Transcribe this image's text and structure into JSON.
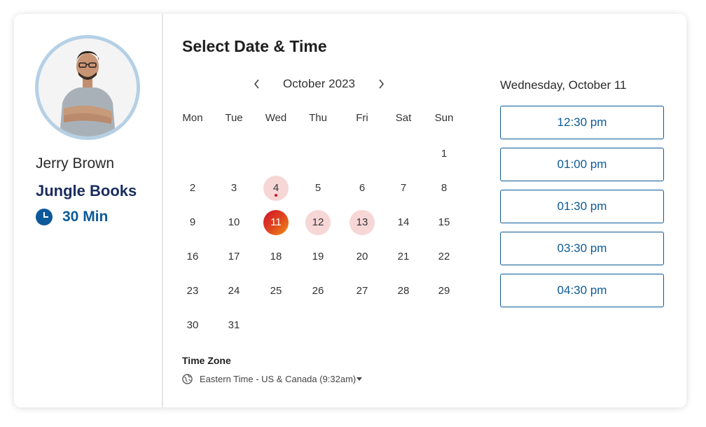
{
  "host": {
    "name": "Jerry Brown",
    "event_name": "Jungle Books",
    "duration": "30 Min",
    "duration_icon": "clock-icon"
  },
  "scheduler": {
    "title": "Select Date & Time",
    "month_label": "October 2023",
    "prev_icon": "chevron-left-icon",
    "next_icon": "chevron-right-icon",
    "weekdays": [
      "Mon",
      "Tue",
      "Wed",
      "Thu",
      "Fri",
      "Sat",
      "Sun"
    ],
    "weeks": [
      [
        "",
        "",
        "",
        "",
        "",
        "",
        "1"
      ],
      [
        "2",
        "3",
        "4",
        "5",
        "6",
        "7",
        "8"
      ],
      [
        "9",
        "10",
        "11",
        "12",
        "13",
        "14",
        "15"
      ],
      [
        "16",
        "17",
        "18",
        "19",
        "20",
        "21",
        "22"
      ],
      [
        "23",
        "24",
        "25",
        "26",
        "27",
        "28",
        "29"
      ],
      [
        "30",
        "31",
        "",
        "",
        "",
        "",
        ""
      ]
    ],
    "today": "4",
    "selected_day": "11",
    "available_days": [
      "4",
      "12",
      "13"
    ]
  },
  "timezone": {
    "label": "Time Zone",
    "value": "Eastern Time - US & Canada (9:32am)",
    "icon": "globe-icon"
  },
  "times": {
    "selected_date": "Wednesday, October 11",
    "slots": [
      "12:30 pm",
      "01:00 pm",
      "01:30 pm",
      "03:30 pm",
      "04:30 pm"
    ]
  },
  "colors": {
    "brand_blue": "#0c5a99",
    "navy_text": "#1a2d5e",
    "available_pink": "#f7d6d6",
    "selected_gradient": [
      "#d0112b",
      "#f39017"
    ],
    "avatar_ring": "#b5d0e5"
  }
}
